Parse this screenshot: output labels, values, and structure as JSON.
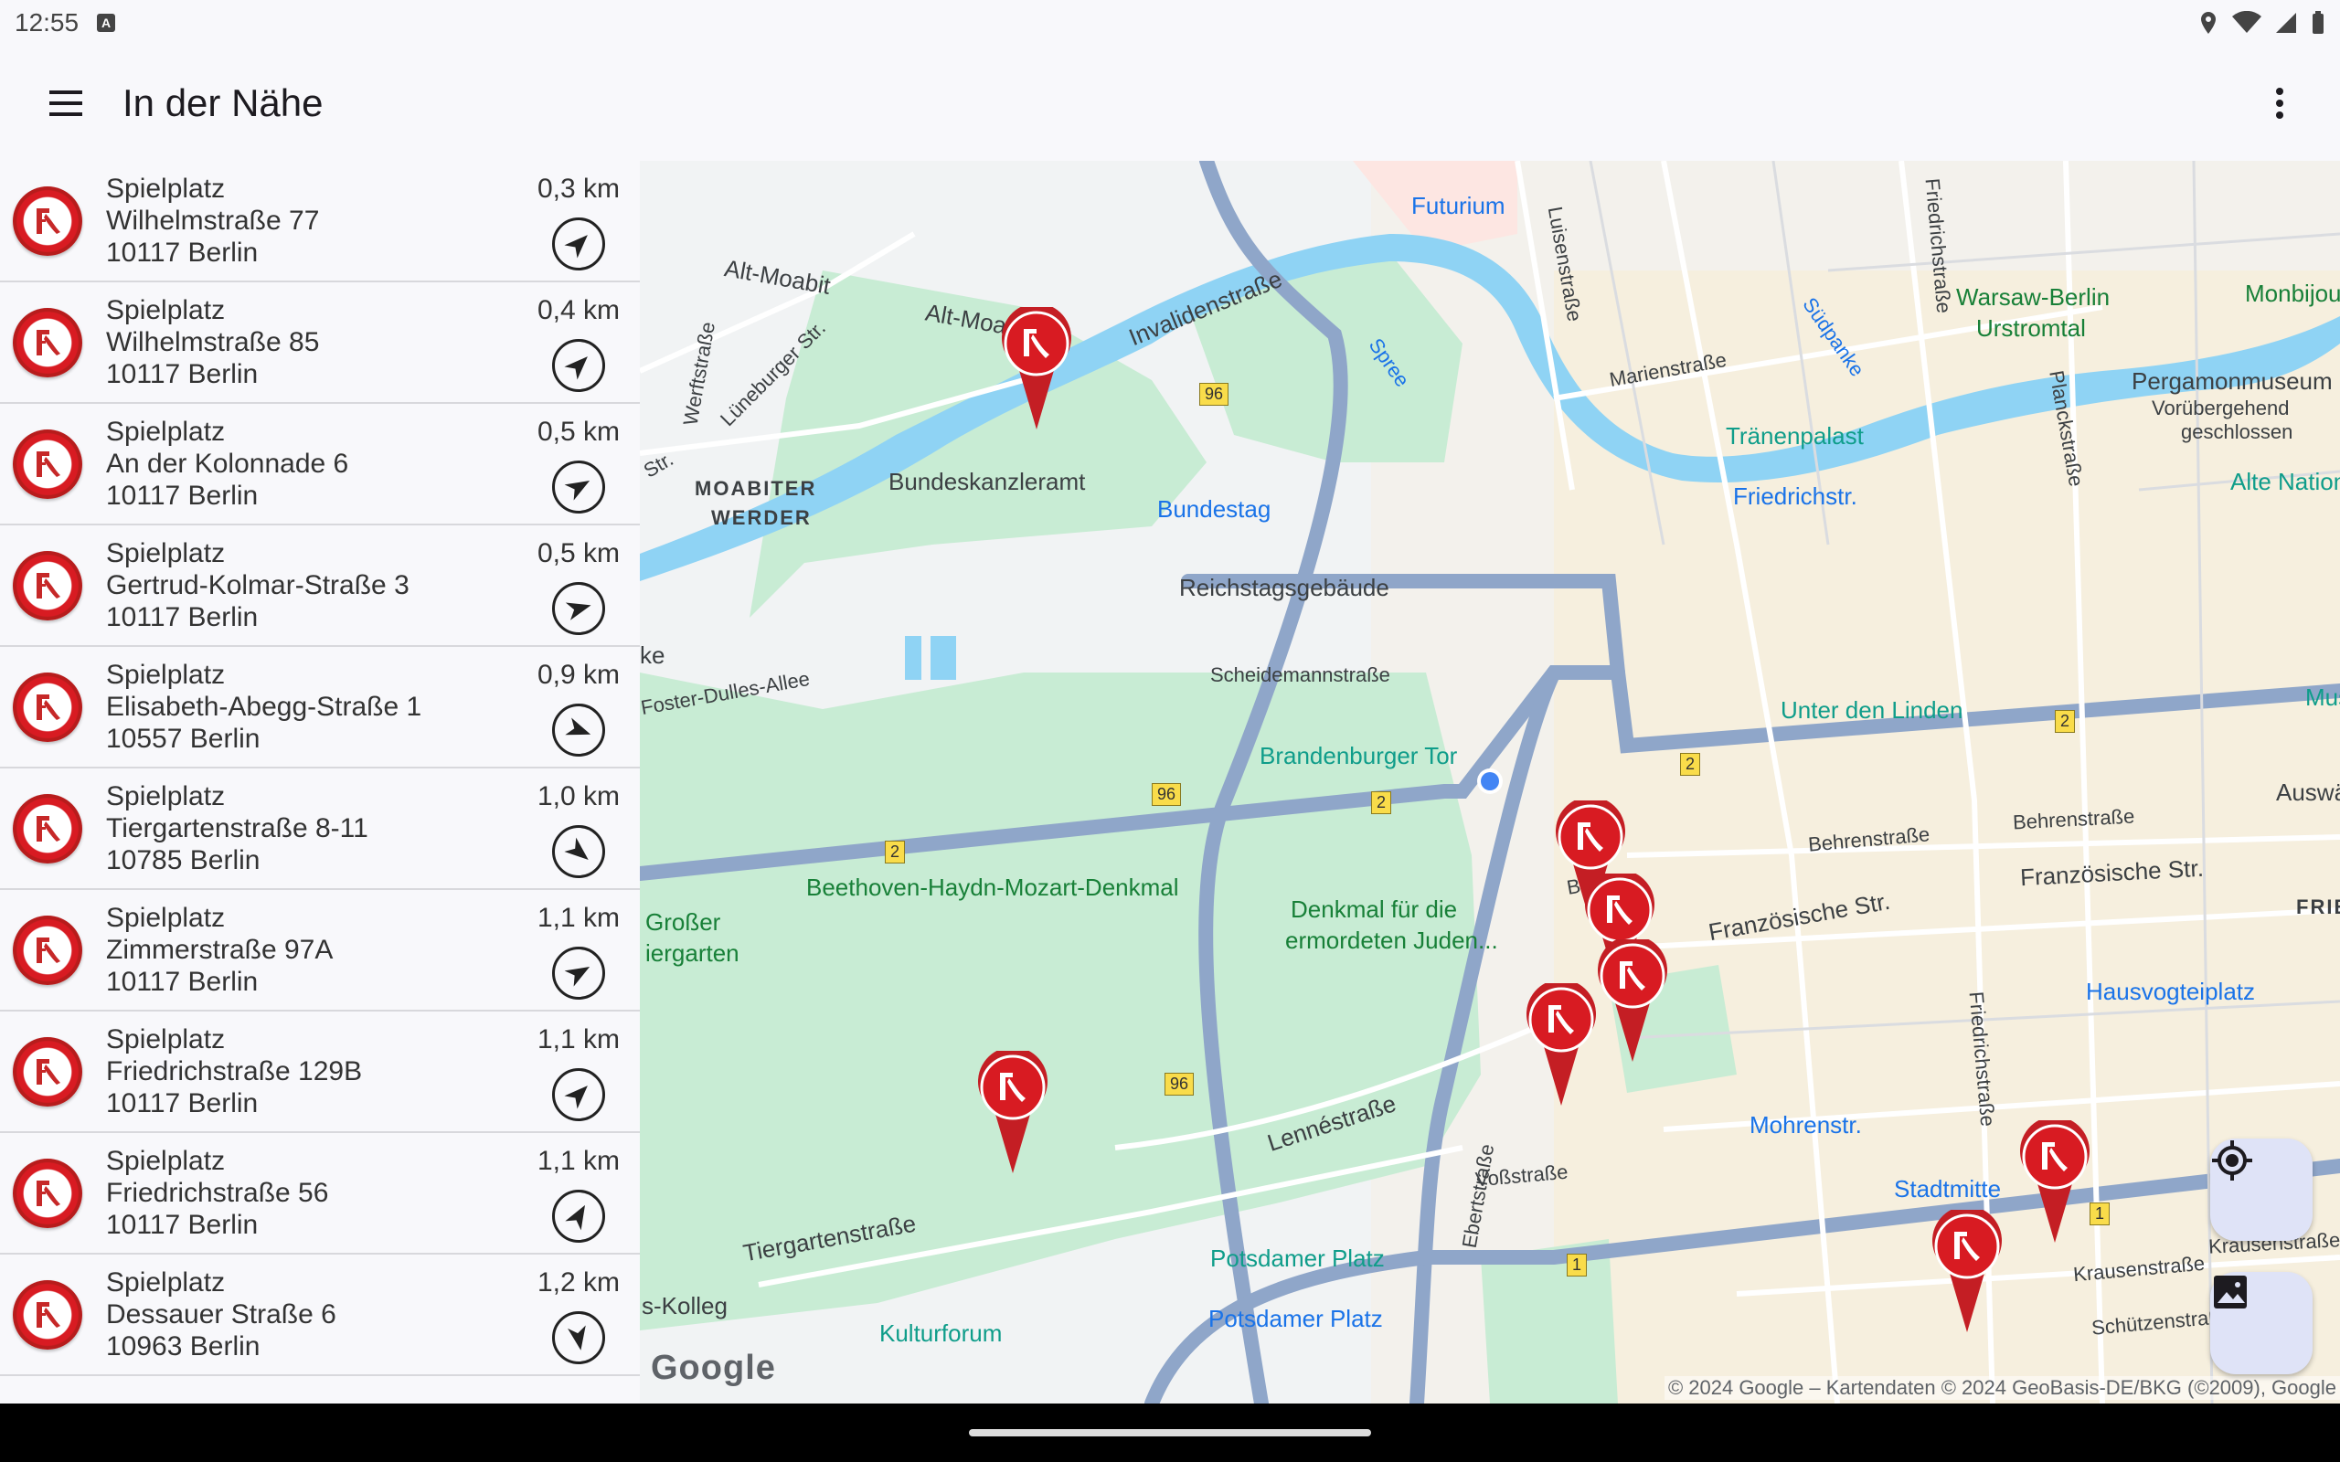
{
  "status": {
    "time": "12:55"
  },
  "app": {
    "title": "In der Nähe"
  },
  "places": [
    {
      "type": "Spielplatz",
      "street": "Wilhelmstraße 77",
      "city": "10117 Berlin",
      "distance": "0,3 km",
      "bearing": 45
    },
    {
      "type": "Spielplatz",
      "street": "Wilhelmstraße 85",
      "city": "10117 Berlin",
      "distance": "0,4 km",
      "bearing": 45
    },
    {
      "type": "Spielplatz",
      "street": "An der Kolonnade 6",
      "city": "10117 Berlin",
      "distance": "0,5 km",
      "bearing": 60
    },
    {
      "type": "Spielplatz",
      "street": "Gertrud-Kolmar-Straße 3",
      "city": "10117 Berlin",
      "distance": "0,5 km",
      "bearing": 75
    },
    {
      "type": "Spielplatz",
      "street": "Elisabeth-Abegg-Straße 1",
      "city": "10557 Berlin",
      "distance": "0,9 km",
      "bearing": 110
    },
    {
      "type": "Spielplatz",
      "street": "Tiergartenstraße 8-11",
      "city": "10785 Berlin",
      "distance": "1,0 km",
      "bearing": 130
    },
    {
      "type": "Spielplatz",
      "street": "Zimmerstraße 97A",
      "city": "10117 Berlin",
      "distance": "1,1 km",
      "bearing": 60
    },
    {
      "type": "Spielplatz",
      "street": "Friedrichstraße 129B",
      "city": "10117 Berlin",
      "distance": "1,1 km",
      "bearing": 45
    },
    {
      "type": "Spielplatz",
      "street": "Friedrichstraße 56",
      "city": "10117 Berlin",
      "distance": "1,1 km",
      "bearing": 30
    },
    {
      "type": "Spielplatz",
      "street": "Dessauer Straße 6",
      "city": "10963 Berlin",
      "distance": "1,2 km",
      "bearing": 170
    }
  ],
  "map": {
    "labels": {
      "futurium": "Futurium",
      "invalidenstrasse": "Invalidenstraße",
      "alt_moabit": "Alt-Moabit",
      "alt_moa": "Alt-Moa",
      "werftstrasse": "Werftstraße",
      "lueneburger": "Lüneburger Str.",
      "str": "Str.",
      "moabiter": "MOABITER",
      "werder": "WERDER",
      "bundeskanzleramt": "Bundeskanzleramt",
      "bundestag": "Bundestag",
      "reichstag": "Reichstagsgebäude",
      "scheidemann": "Scheidemannstraße",
      "brandenburger": "Brandenburger Tor",
      "foster": "Foster-Dulles-Allee",
      "ke": "ke",
      "beethoven": "Beethoven-Haydn-Mozart-Denkmal",
      "grosser": "Großer",
      "tiergarten": "iergarten",
      "denkmal1": "Denkmal für die",
      "denkmal2": "ermordeten Juden...",
      "luisenstrasse": "Luisenstraße",
      "marienstrasse": "Marienstraße",
      "spree": "Spree",
      "suedpanke": "Südpanke",
      "friedrichstrasse_n": "Friedrichstraße",
      "warsaw1": "Warsaw-Berlin",
      "warsaw2": "Urstromtal",
      "monbijou": "Monbijoup",
      "pergamon": "Pergamonmuseum",
      "pergamon2": "Vorübergehend",
      "pergamon3": "geschlossen",
      "traenenpalast": "Tränenpalast",
      "friedrichstr": "Friedrichstr.",
      "alte_national": "Alte Nationa",
      "plancke": "Planckstraße",
      "unter_den_linden": "Unter den Linden",
      "mus": "Mus",
      "behrenstrasse_l": "Behrenstraße",
      "behrenstrasse_r": "Behrenstraße",
      "behre": "Behre",
      "auswaert": "Auswärt",
      "franzoesische": "Französische Str.",
      "franzoesische2": "Französische Str.",
      "frie": "FRIE",
      "hausvogteiplatz": "Hausvogteiplatz",
      "friedrichstrasse_s": "Friedrichstraße",
      "mohrenstr": "Mohrenstr.",
      "ebertstrasse": "Ebertstraße",
      "lennestrasse": "Lennéstraße",
      "vossstrasse": "Voßstraße",
      "stadtmitte": "Stadtmitte",
      "krausenstrasse": "Krausenstraße",
      "krausenstrasse2": "Krausenstraße",
      "schuetzenstrasse": "Schützenstraße",
      "tiergartenstrasse": "Tiergartenstraße",
      "potsdamer_platz1": "Potsdamer Platz",
      "potsdamer_platz2": "Potsdamer Platz",
      "kolleg": "s-Kolleg",
      "kulturforum": "Kulturforum"
    },
    "route_badges": [
      "96",
      "96",
      "96",
      "2",
      "2",
      "2",
      "2",
      "1",
      "1"
    ],
    "attribution": "© 2024 Google – Kartendaten © 2024 GeoBasis-DE/BKG (©2009), Google",
    "google": "Google"
  },
  "colors": {
    "marker": "#d81b22",
    "accent": "#1a73e8",
    "park": "#c8ecd4",
    "water": "#8fd3f4",
    "road": "#8fa6c9"
  }
}
